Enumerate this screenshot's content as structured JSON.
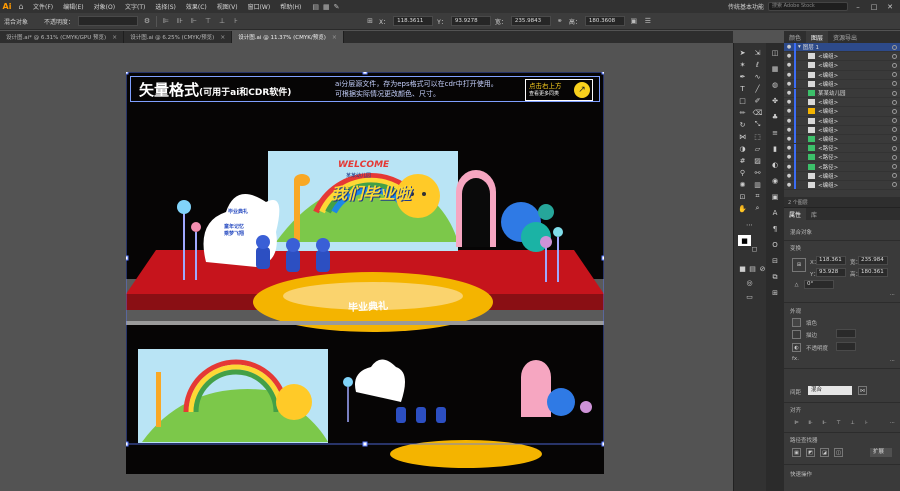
{
  "app": {
    "logo": "Ai",
    "workspace": "传统基本功能",
    "search_placeholder": "搜索 Adobe Stock"
  },
  "menu": [
    "文件(F)",
    "编辑(E)",
    "对象(O)",
    "文字(T)",
    "选择(S)",
    "效果(C)",
    "视图(V)",
    "窗口(W)",
    "帮助(H)"
  ],
  "control_bar": {
    "selection": "混合对象",
    "opacity_label": "不透明度：",
    "x_label": "X：",
    "x_value": "118.3611",
    "y_label": "Y：",
    "y_value": "93.9278",
    "w_label": "宽：",
    "w_value": "235.9843",
    "h_label": "高：",
    "h_value": "180.3608"
  },
  "tabs": [
    {
      "label": "设计图.ai* @ 6.31% (CMYK/GPU 预览)",
      "close": "×"
    },
    {
      "label": "设计图.ai @ 6.25% (CMYK/预览)",
      "close": "×"
    },
    {
      "label": "设计图.ai @ 11.37% (CMYK/预览)",
      "close": "×"
    }
  ],
  "banner": {
    "title": "矢量格式",
    "title_sub": "(可用于ai和CDR软件)",
    "line1": "ai分层源文件，存为eps格式可以在cdr中打开使用。",
    "line2": "可根据实际情况更改颜色、尺寸。",
    "btn_line1": "点击右上方",
    "btn_line2": "查看更多同类",
    "btn_icon": "↗"
  },
  "scene": {
    "welcome": "WELCOME",
    "kindergarten": "某某幼儿园",
    "graduation": "我们毕业啦",
    "sign_left_1": "童年记忆",
    "sign_left_2": "乘梦飞翔",
    "sign_top": "毕业典礼",
    "stage_text": "毕业典礼"
  },
  "layers_panel": {
    "tabs": [
      "颜色",
      "图层",
      "资源导出"
    ],
    "rows": [
      {
        "name": "图层 1"
      },
      {
        "name": "<编组>"
      },
      {
        "name": "<编组>"
      },
      {
        "name": "<编组>"
      },
      {
        "name": "<编组>"
      },
      {
        "name": "某某幼儿园"
      },
      {
        "name": "<编组>"
      },
      {
        "name": "<编组>"
      },
      {
        "name": "<编组>"
      },
      {
        "name": "<编组>"
      },
      {
        "name": "<编组>"
      },
      {
        "name": "<路径>"
      },
      {
        "name": "<路径>"
      },
      {
        "name": "<路径>"
      },
      {
        "name": "<编组>"
      },
      {
        "name": "<编组>"
      }
    ],
    "footer": "2 个图层"
  },
  "props_panel": {
    "tabs": [
      "属性",
      "库"
    ],
    "object": "混合对象",
    "transform": "变换",
    "x_label": "X：",
    "x": "118.361",
    "y_label": "Y：",
    "y": "93.928",
    "w_label": "宽：",
    "w": "235.984",
    "h_label": "高：",
    "h": "180.361",
    "angle": "0°",
    "appearance": "外观",
    "fill": "填色",
    "stroke": "描边",
    "opacity": "不透明度",
    "fx": "fx.",
    "blend_label": "间距",
    "blend_value": "混合",
    "align": "对齐",
    "pathfinder": "路径查找器",
    "quick_actions": "快速操作",
    "expand": "扩展"
  },
  "colors": {
    "accent": "#3b6cf5",
    "stage_red": "#c6141c",
    "stage_yellow": "#f4b400"
  }
}
